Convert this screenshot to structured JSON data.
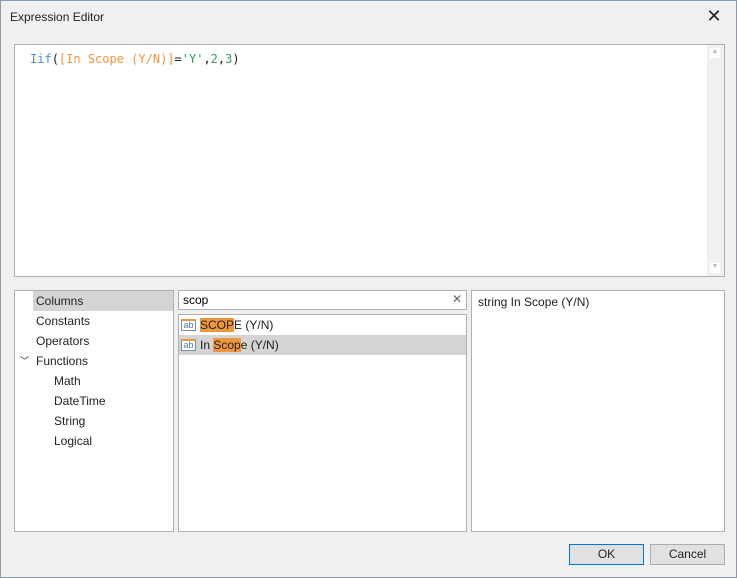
{
  "window": {
    "title": "Expression Editor"
  },
  "expression": {
    "func": "Iif",
    "open": "(",
    "column": "[In Scope (Y/N)]",
    "op": "=",
    "string": "'Y'",
    "c1": ",",
    "n1": "2",
    "c2": ",",
    "n2": "3",
    "close": ")"
  },
  "categories": [
    {
      "label": "Columns",
      "selected": true
    },
    {
      "label": "Constants"
    },
    {
      "label": "Operators"
    },
    {
      "label": "Functions",
      "expanded": true
    }
  ],
  "functions": [
    "Math",
    "DateTime",
    "String",
    "Logical"
  ],
  "search": {
    "value": "scop"
  },
  "items": [
    {
      "match": "SCOP",
      "rest": "E (Y/N)",
      "pre": ""
    },
    {
      "pre": "In ",
      "match": "Scop",
      "rest": "e (Y/N)",
      "selected": true
    }
  ],
  "item_icon": "string-field-icon",
  "description": "string In Scope (Y/N)",
  "buttons": {
    "ok": "OK",
    "cancel": "Cancel"
  },
  "colors": {
    "function": "#4a90d9",
    "column": "#f0963c",
    "literal": "#3a9a5a",
    "highlight": "#f0963c"
  }
}
